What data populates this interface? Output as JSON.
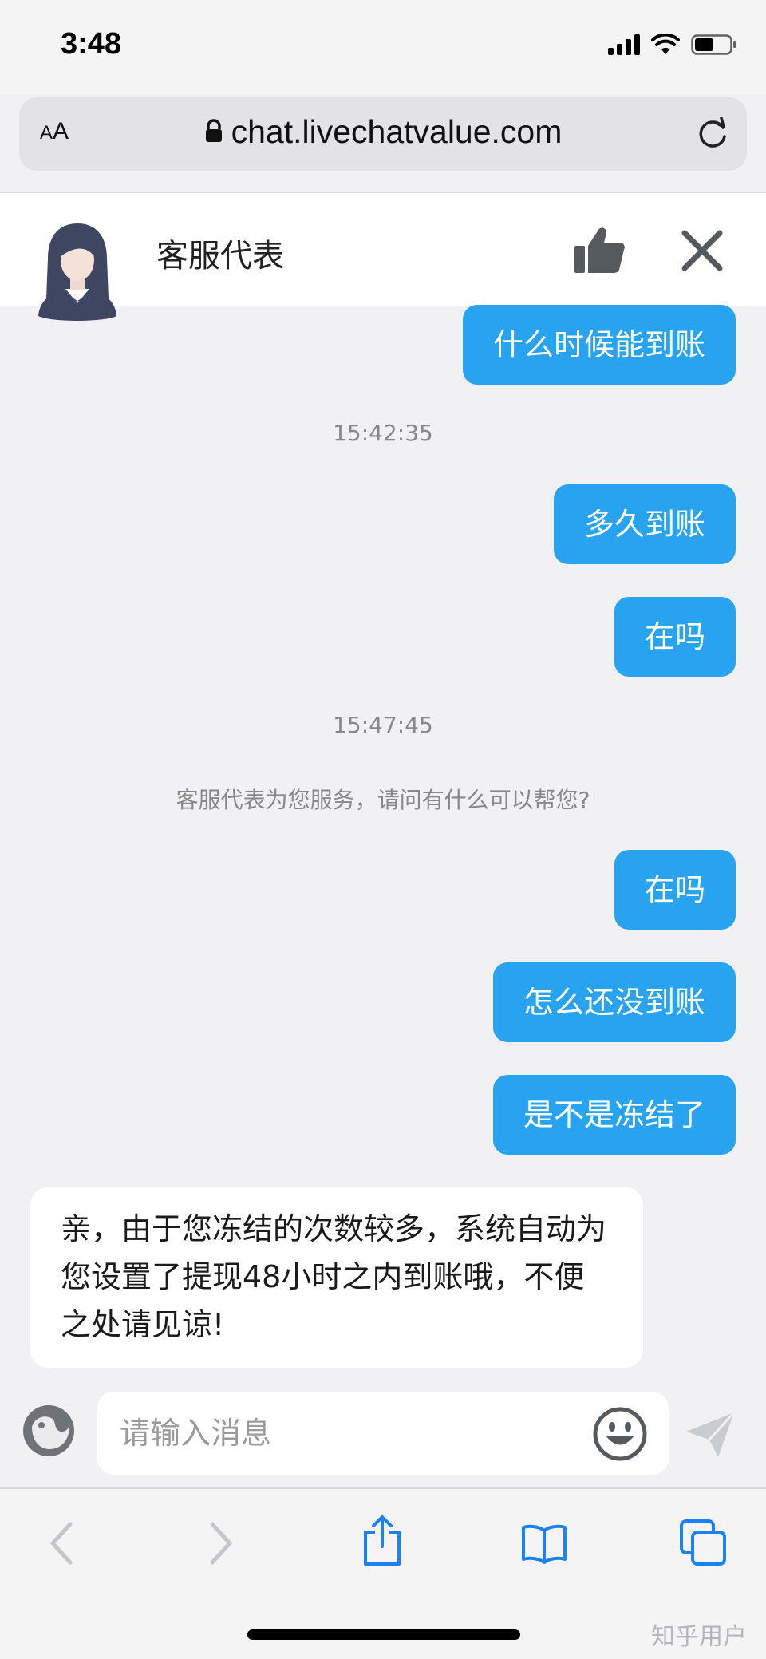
{
  "status_bar": {
    "time": "3:48",
    "battery_level": 0.55
  },
  "browser": {
    "text_size_label": "AA",
    "url": "chat.livechatvalue.com"
  },
  "chat_header": {
    "agent_name": "客服代表"
  },
  "messages": {
    "m1": "什么时候能到账",
    "t1": "15:42:35",
    "m2": "多久到账",
    "m3": "在吗",
    "t2": "15:47:45",
    "system": "客服代表为您服务，请问有什么可以帮您?",
    "m4": "在吗",
    "m5": "怎么还没到账",
    "m6": "是不是冻结了",
    "reply": "亲，由于您冻结的次数较多，系统自动为您设置了提现48小时之内到账哦，不便之处请见谅!"
  },
  "input": {
    "placeholder": "请输入消息"
  },
  "colors": {
    "accent": "#28a3ef",
    "icon_gray": "#555a5f",
    "toolbar_blue": "#1a82f6"
  },
  "watermark": "知乎用户"
}
